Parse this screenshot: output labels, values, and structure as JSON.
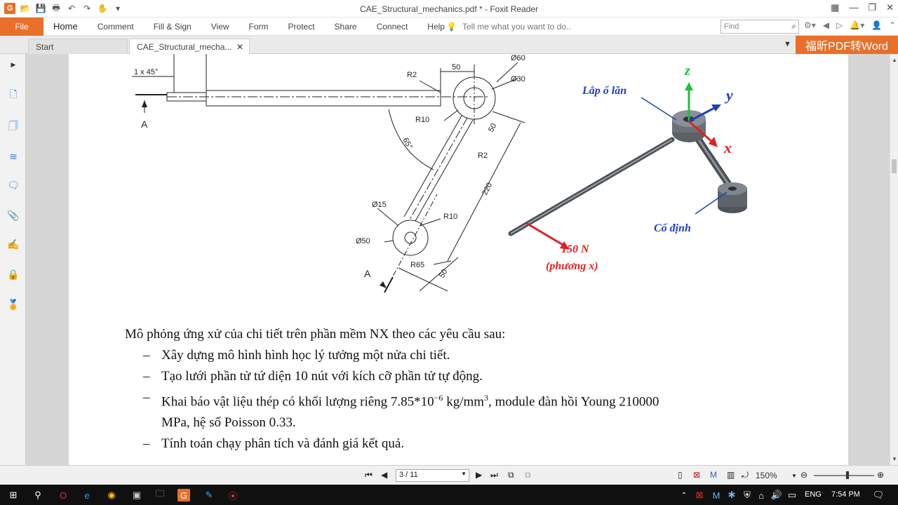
{
  "titlebar": {
    "title": "CAE_Structural_mechanics.pdf * - Foxit Reader"
  },
  "ribbon": {
    "file": "File",
    "menu": [
      "Home",
      "Comment",
      "Fill & Sign",
      "View",
      "Form",
      "Protect",
      "Share",
      "Connect",
      "Help"
    ],
    "tell_me": "Tell me what you want to do..",
    "find_placeholder": "Find"
  },
  "tabs": {
    "start": "Start",
    "doc": "CAE_Structural_mecha..."
  },
  "promo": "福昕PDF转Word",
  "drawing": {
    "chamfer": "1 x 45°",
    "section_a_top": "A",
    "section_a_bottom": "A",
    "dim_50_top": "50",
    "dim_d60": "Ø60",
    "dim_d30": "Ø30",
    "r2_top": "R2",
    "r10_top": "R10",
    "angle": "65°",
    "dim_50_side": "50",
    "r2_side": "R2",
    "dim_220": "220",
    "dim_d15": "Ø15",
    "r10_bottom": "R10",
    "dim_d50": "Ø50",
    "r65": "R65",
    "dim_50_bottom": "50"
  },
  "model": {
    "axis_z": "z",
    "axis_y": "y",
    "axis_x": "x",
    "bearing": "Lắp ổ lăn",
    "fixed": "Cố định",
    "load": "150 N",
    "load_dir": "(phương x)"
  },
  "content": {
    "intro": "Mô phỏng ứng xử của chi tiết trên phần mềm NX theo các yêu cầu sau:",
    "item1": "Xây dựng mô hình hình học lý tưởng một nửa chi tiết.",
    "item2": "Tạo lưới phần tử tứ diện 10 nút với kích cỡ phần tử tự động.",
    "item3a": "Khai báo vật liệu thép có khối lượng riêng 7.85*10",
    "item3_exp": "−6",
    "item3b": " kg/mm",
    "item3_exp2": "3",
    "item3c": ", module đàn hồi Young 210000",
    "item3_line2": "MPa, hệ số Poisson 0.33.",
    "item4": "Tính toán chạy phân tích và đánh giá kết quả."
  },
  "statusbar": {
    "page": "3 / 11",
    "zoom": "150%"
  },
  "taskbar": {
    "lang": "ENG",
    "time": "7:54 PM"
  },
  "colors": {
    "accent": "#e8702a",
    "load_arrow": "#e02020",
    "label_blue": "#1f3fbf",
    "axis_green": "#1fbf3a"
  }
}
